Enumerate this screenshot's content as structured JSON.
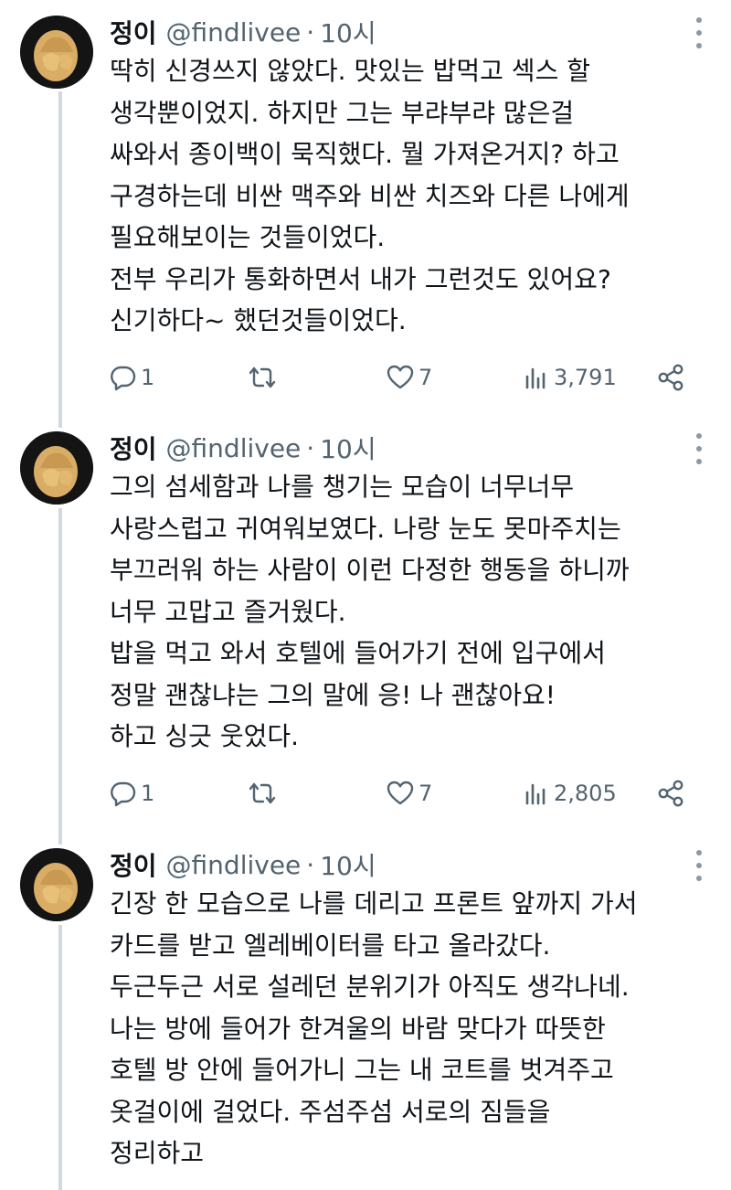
{
  "tweets": [
    {
      "name": "정이",
      "handle": "@findlivee",
      "dot": "·",
      "time": "10시",
      "lines": [
        "딱히 신경쓰지 않았다. 맛있는 밥먹고 섹스 할",
        "생각뿐이었지. 하지만 그는 부랴부랴 많은걸",
        "싸와서 종이백이 묵직했다. 뭘 가져온거지? 하고",
        "구경하는데 비싼 맥주와 비싼 치즈와 다른 나에게",
        "필요해보이는 것들이었다.",
        "전부 우리가 통화하면서 내가 그런것도 있어요?",
        "신기하다~ 했던것들이었다."
      ],
      "replies": "1",
      "retweets": "",
      "likes": "7",
      "views": "3,791"
    },
    {
      "name": "정이",
      "handle": "@findlivee",
      "dot": "·",
      "time": "10시",
      "lines": [
        "그의 섬세함과 나를 챙기는 모습이 너무너무",
        "사랑스럽고 귀여워보였다. 나랑 눈도 못마주치는",
        "부끄러워 하는 사람이 이런 다정한 행동을 하니까",
        "너무 고맙고 즐거웠다.",
        "밥을 먹고 와서 호텔에 들어가기 전에 입구에서",
        "정말 괜찮냐는 그의 말에 응! 나 괜찮아요!",
        "하고 싱긋 웃었다."
      ],
      "replies": "1",
      "retweets": "",
      "likes": "7",
      "views": "2,805"
    },
    {
      "name": "정이",
      "handle": "@findlivee",
      "dot": "·",
      "time": "10시",
      "lines": [
        "긴장 한 모습으로 나를 데리고 프론트 앞까지 가서",
        "카드를 받고 엘레베이터를 타고 올라갔다.",
        "두근두근 서로 설레던 분위기가 아직도 생각나네.",
        "나는 방에 들어가 한겨울의 바람 맞다가 따뜻한",
        "호텔 방 안에 들어가니 그는 내 코트를 벗겨주고",
        "옷걸이에 걸었다. 주섬주섬 서로의 짐들을",
        "정리하고"
      ]
    }
  ],
  "icons": {
    "reply": "reply-icon",
    "retweet": "retweet-icon",
    "like": "heart-icon",
    "views": "views-icon",
    "share": "share-icon",
    "more": "more-icon"
  },
  "colors": {
    "text": "#0f1419",
    "muted": "#536471",
    "thread_line": "#cfd9de"
  }
}
